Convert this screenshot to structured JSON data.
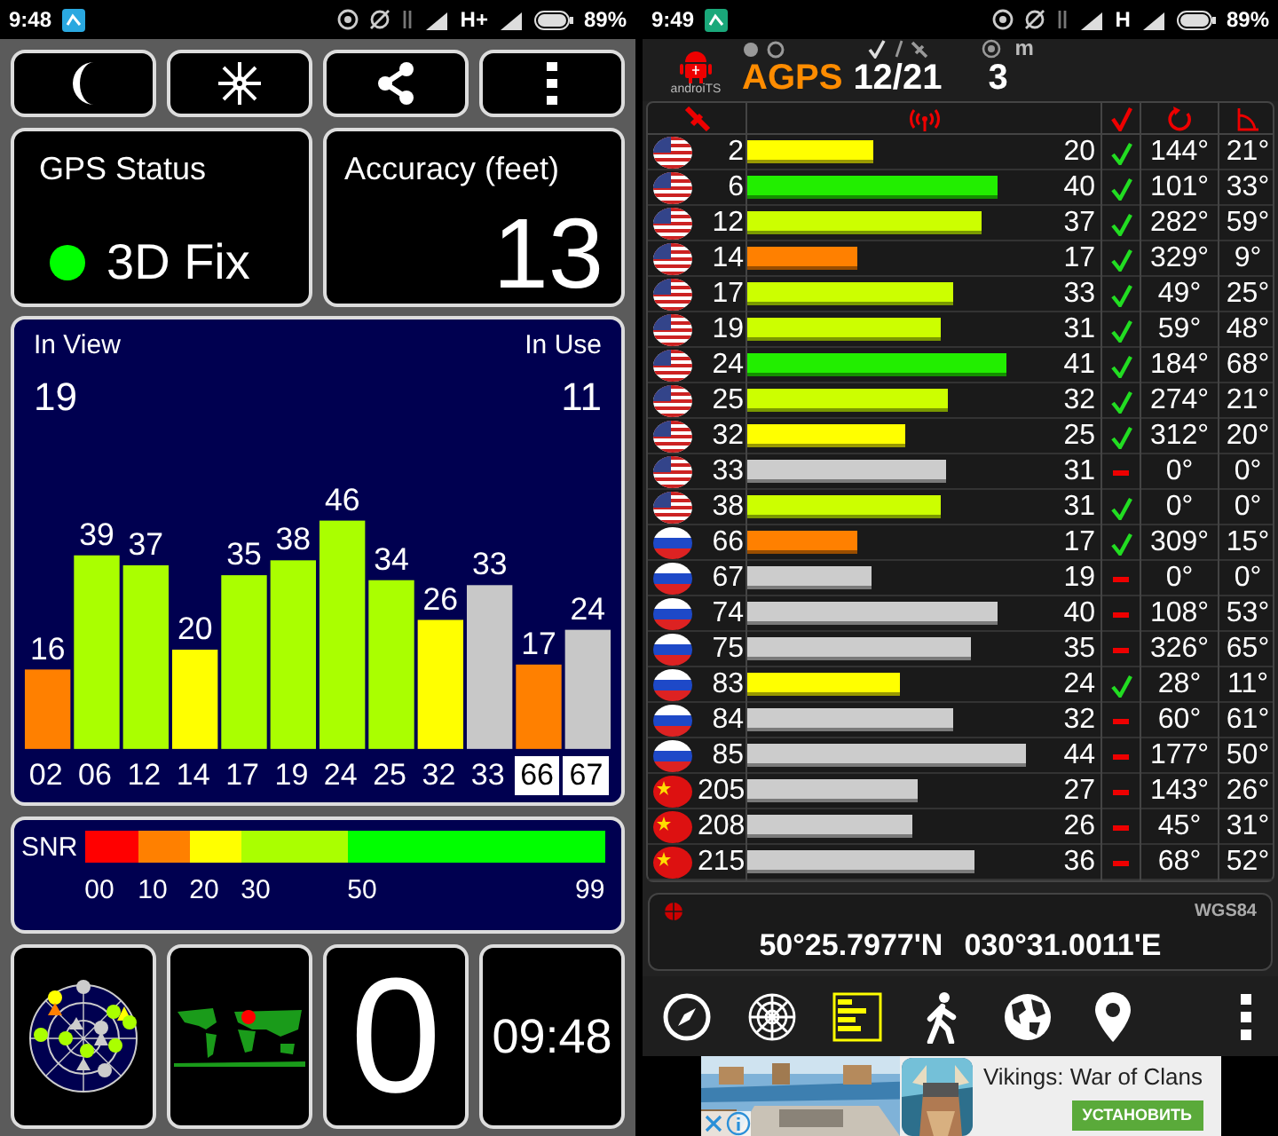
{
  "left": {
    "status_bar": {
      "time": "9:48",
      "network": "H+",
      "battery": "89%"
    },
    "buttons": [
      {
        "kind": "moon"
      },
      {
        "kind": "star"
      },
      {
        "kind": "share"
      },
      {
        "kind": "more"
      }
    ],
    "gps_status": {
      "title": "GPS Status",
      "value": "3D Fix",
      "color": "#00ff00"
    },
    "accuracy": {
      "title": "Accuracy (feet)",
      "value": "13"
    },
    "sky_chart": {
      "in_view_label": "In View",
      "in_view": "19",
      "in_use_label": "In Use",
      "in_use": "11",
      "chart_data": {
        "type": "bar",
        "categories": [
          "02",
          "06",
          "12",
          "14",
          "17",
          "19",
          "24",
          "25",
          "32",
          "33",
          "66",
          "67"
        ],
        "values": [
          16,
          39,
          37,
          20,
          35,
          38,
          46,
          34,
          26,
          33,
          17,
          24
        ],
        "data_labels": true
      },
      "satellites": [
        {
          "color": "#ff8000",
          "highlighted": false
        },
        {
          "color": "#aaff00",
          "highlighted": false
        },
        {
          "color": "#aaff00",
          "highlighted": false
        },
        {
          "color": "#ffff00",
          "highlighted": false
        },
        {
          "color": "#aaff00",
          "highlighted": false
        },
        {
          "color": "#aaff00",
          "highlighted": false
        },
        {
          "color": "#aaff00",
          "highlighted": false
        },
        {
          "color": "#aaff00",
          "highlighted": false
        },
        {
          "color": "#ffff00",
          "highlighted": false
        },
        {
          "color": "#c8c8c8",
          "highlighted": false
        },
        {
          "color": "#ff8000",
          "highlighted": true
        },
        {
          "color": "#c8c8c8",
          "highlighted": true
        }
      ]
    },
    "snr_legend": {
      "label": "SNR",
      "segments": [
        {
          "label": "00",
          "color": "#ff0000"
        },
        {
          "label": "10",
          "color": "#ff8000"
        },
        {
          "label": "20",
          "color": "#ffff00"
        },
        {
          "label": "30",
          "color": "#aaff00"
        },
        {
          "label": "50",
          "color": "#00ff00"
        }
      ],
      "end_label": "99"
    },
    "tiles": {
      "speed": "0",
      "clock": "09:48"
    }
  },
  "right": {
    "status_bar": {
      "time": "9:49",
      "network": "H",
      "battery": "89%"
    },
    "header": {
      "logo_text": "androiTS",
      "mode": "AGPS",
      "used_total": "12/21",
      "accuracy": "3",
      "accuracy_unit": "m"
    },
    "rows": [
      {
        "kind": "us",
        "prn": "2",
        "level": 0.355,
        "color": "#ffff00",
        "snr": "20",
        "used": true,
        "azimuth": "144°",
        "elevation": "21°"
      },
      {
        "kind": "us",
        "prn": "6",
        "level": 0.71,
        "color": "#22ee00",
        "snr": "40",
        "used": true,
        "azimuth": "101°",
        "elevation": "33°"
      },
      {
        "kind": "us",
        "prn": "12",
        "level": 0.665,
        "color": "#ccff00",
        "snr": "37",
        "used": true,
        "azimuth": "282°",
        "elevation": "59°"
      },
      {
        "kind": "us",
        "prn": "14",
        "level": 0.31,
        "color": "#ff8000",
        "snr": "17",
        "used": true,
        "azimuth": "329°",
        "elevation": "9°"
      },
      {
        "kind": "us",
        "prn": "17",
        "level": 0.585,
        "color": "#ccff00",
        "snr": "33",
        "used": true,
        "azimuth": "49°",
        "elevation": "25°"
      },
      {
        "kind": "us",
        "prn": "19",
        "level": 0.55,
        "color": "#ccff00",
        "snr": "31",
        "used": true,
        "azimuth": "59°",
        "elevation": "48°"
      },
      {
        "kind": "us",
        "prn": "24",
        "level": 0.735,
        "color": "#22ee00",
        "snr": "41",
        "used": true,
        "azimuth": "184°",
        "elevation": "68°"
      },
      {
        "kind": "us",
        "prn": "25",
        "level": 0.57,
        "color": "#ccff00",
        "snr": "32",
        "used": true,
        "azimuth": "274°",
        "elevation": "21°"
      },
      {
        "kind": "us",
        "prn": "32",
        "level": 0.445,
        "color": "#ffff00",
        "snr": "25",
        "used": true,
        "azimuth": "312°",
        "elevation": "20°"
      },
      {
        "kind": "us",
        "prn": "33",
        "level": 0.565,
        "color": "#cccccc",
        "snr": "31",
        "used": false,
        "azimuth": "0°",
        "elevation": "0°"
      },
      {
        "kind": "us",
        "prn": "38",
        "level": 0.55,
        "color": "#ccff00",
        "snr": "31",
        "used": true,
        "azimuth": "0°",
        "elevation": "0°"
      },
      {
        "kind": "ru",
        "prn": "66",
        "level": 0.31,
        "color": "#ff8000",
        "snr": "17",
        "used": true,
        "azimuth": "309°",
        "elevation": "15°"
      },
      {
        "kind": "ru",
        "prn": "67",
        "level": 0.35,
        "color": "#cccccc",
        "snr": "19",
        "used": false,
        "azimuth": "0°",
        "elevation": "0°"
      },
      {
        "kind": "ru",
        "prn": "74",
        "level": 0.71,
        "color": "#cccccc",
        "snr": "40",
        "used": false,
        "azimuth": "108°",
        "elevation": "53°"
      },
      {
        "kind": "ru",
        "prn": "75",
        "level": 0.635,
        "color": "#cccccc",
        "snr": "35",
        "used": false,
        "azimuth": "326°",
        "elevation": "65°"
      },
      {
        "kind": "ru",
        "prn": "83",
        "level": 0.43,
        "color": "#ffff00",
        "snr": "24",
        "used": true,
        "azimuth": "28°",
        "elevation": "11°"
      },
      {
        "kind": "ru",
        "prn": "84",
        "level": 0.585,
        "color": "#cccccc",
        "snr": "32",
        "used": false,
        "azimuth": "60°",
        "elevation": "61°"
      },
      {
        "kind": "ru",
        "prn": "85",
        "level": 0.79,
        "color": "#cccccc",
        "snr": "44",
        "used": false,
        "azimuth": "177°",
        "elevation": "50°"
      },
      {
        "kind": "cn",
        "prn": "205",
        "level": 0.48,
        "color": "#cccccc",
        "snr": "27",
        "used": false,
        "azimuth": "143°",
        "elevation": "26°"
      },
      {
        "kind": "cn",
        "prn": "208",
        "level": 0.465,
        "color": "#cccccc",
        "snr": "26",
        "used": false,
        "azimuth": "45°",
        "elevation": "31°"
      },
      {
        "kind": "cn",
        "prn": "215",
        "level": 0.645,
        "color": "#cccccc",
        "snr": "36",
        "used": false,
        "azimuth": "68°",
        "elevation": "52°"
      }
    ],
    "position": {
      "datum": "WGS84",
      "latitude": "50°25.7977'N",
      "longitude": "030°31.0011'E"
    },
    "toolbar": [
      {
        "kind": "compass",
        "selected": false
      },
      {
        "kind": "radar",
        "selected": false
      },
      {
        "kind": "bars",
        "selected": true
      },
      {
        "kind": "walk",
        "selected": false
      },
      {
        "kind": "globe",
        "selected": false
      },
      {
        "kind": "pin",
        "selected": false
      }
    ],
    "ad": {
      "title": "Vikings: War of Clans",
      "button": "УСТАНОВИТЬ"
    }
  }
}
